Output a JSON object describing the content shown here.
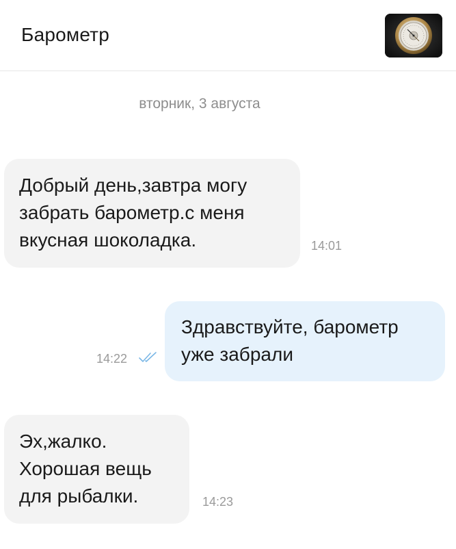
{
  "header": {
    "title": "Барометр",
    "avatar_icon": "barometer-photo"
  },
  "date_separator": "вторник, 3 августа",
  "messages": [
    {
      "direction": "incoming",
      "lines": [
        "Добрый день,завтра могу",
        "забрать барометр.с меня",
        "вкусная шоколадка."
      ],
      "time": "14:01"
    },
    {
      "direction": "outgoing",
      "lines": [
        "Здравствуйте, барометр",
        "уже забрали"
      ],
      "time": "14:22",
      "status_icon": "double-check-icon"
    },
    {
      "direction": "incoming",
      "lines": [
        "Эх,жалко.",
        "Хорошая вещь",
        "для рыбалки."
      ],
      "time": "14:23"
    }
  ],
  "colors": {
    "incoming_bubble": "#f3f3f3",
    "outgoing_bubble": "#e6f2fc",
    "read_check": "#7ab7e6",
    "muted_text": "#9a9a9a"
  }
}
